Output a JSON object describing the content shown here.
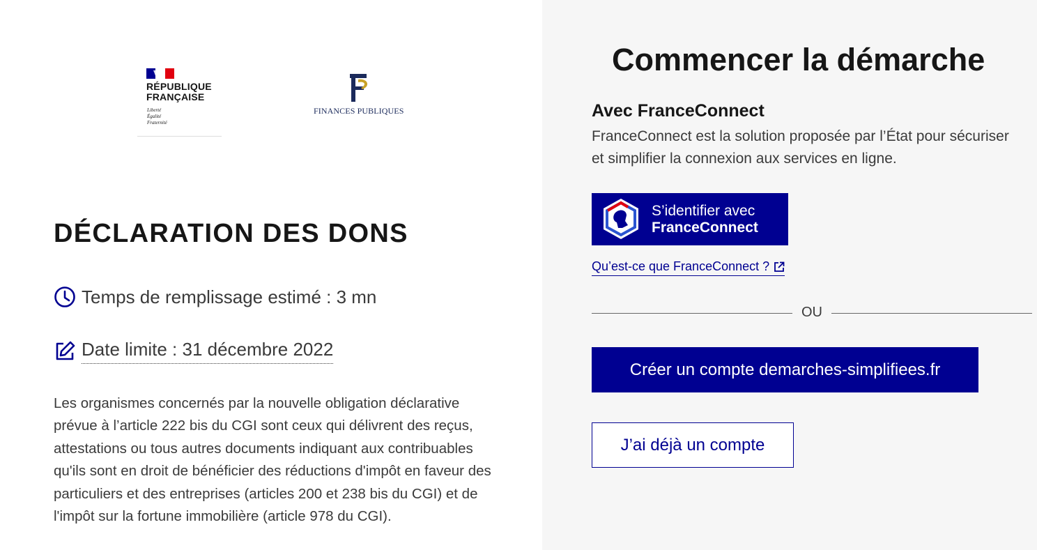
{
  "logos": {
    "republique": {
      "title": "RÉPUBLIQUE\nFRANÇAISE",
      "motto": "Liberté\nÉgalité\nFraternité"
    },
    "finances": {
      "label": "FINANCES PUBLIQUES"
    }
  },
  "main": {
    "title": "DÉCLARATION DES DONS",
    "duration": "Temps de remplissage estimé : 3 mn",
    "deadline": "Date limite : 31 décembre 2022",
    "description": "Les organismes concernés par la nouvelle obligation déclarative prévue à l’article 222 bis du CGI sont ceux qui délivrent des reçus, attestations ou tous autres documents indiquant aux contribuables qu'ils sont en droit de bénéficier des réductions d'impôt en faveur des particuliers et des entreprises (articles 200 et 238 bis du CGI) et de l'impôt sur la fortune immobilière (article 978 du CGI)."
  },
  "start": {
    "title": "Commencer la démarche",
    "fc_heading": "Avec FranceConnect",
    "fc_description": "FranceConnect est la solution proposée par l’État pour sécuriser et simplifier la connexion aux services en ligne.",
    "fc_button_line1": "S’identifier avec",
    "fc_button_line2": "FranceConnect",
    "fc_link": "Qu’est-ce que FranceConnect ?",
    "separator": "OU",
    "create_account": "Créer un compte demarches-simplifiees.fr",
    "existing_account": "J’ai déjà un compte"
  },
  "colors": {
    "primary": "#000091",
    "panel_bg": "#f6f6f6",
    "text": "#161616"
  },
  "icons": [
    "clock-icon",
    "edit-icon",
    "external-link-icon",
    "marianne-icon"
  ]
}
